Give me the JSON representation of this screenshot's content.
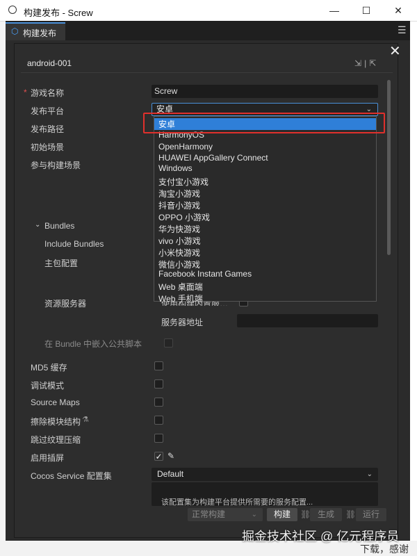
{
  "window": {
    "title": "构建发布 - Screw",
    "minimize": "—",
    "maximize": "☐",
    "close": "✕"
  },
  "tab": {
    "label": "构建发布",
    "icon": "build-icon"
  },
  "panel": {
    "config_name": "android-001",
    "close_label": "✕"
  },
  "form": {
    "game_name": {
      "label": "游戏名称",
      "value": "Screw",
      "required_mark": "*"
    },
    "platform": {
      "label": "发布平台",
      "value": "安卓"
    },
    "build_path": {
      "label": "发布路径"
    },
    "start_scene": {
      "label": "初始场景"
    },
    "build_scenes": {
      "label": "参与构建场景"
    },
    "bundles": {
      "label": "Bundles"
    },
    "include_bundles": {
      "label": "Include Bundles"
    },
    "main_bundle": {
      "label": "主包配置"
    },
    "resource_server": {
      "label": "资源服务器",
      "builtin_label": "使用构建内置服…"
    },
    "server_address": {
      "label": "服务器地址",
      "value": ""
    },
    "embed_scripts": {
      "label": "在 Bundle 中嵌入公共脚本",
      "checked": false
    },
    "md5": {
      "label": "MD5 缓存",
      "checked": false
    },
    "debug": {
      "label": "调试模式",
      "checked": false
    },
    "source_maps": {
      "label": "Source Maps",
      "checked": false
    },
    "erase_modules": {
      "label": "擦除模块结构",
      "checked": false
    },
    "skip_texture": {
      "label": "跳过纹理压缩",
      "checked": false
    },
    "splash": {
      "label": "启用插屏",
      "checked": true
    },
    "cocos_service": {
      "label": "Cocos Service 配置集",
      "value": "Default"
    },
    "service_desc": "该配置集为构建平台提供所需要的服务配置..."
  },
  "dropdown_options": [
    "安卓",
    "HarmonyOS",
    "OpenHarmony",
    "HUAWEI AppGallery Connect",
    "Windows",
    "支付宝小游戏",
    "淘宝小游戏",
    "抖音小游戏",
    "OPPO 小游戏",
    "华为快游戏",
    "vivo 小游戏",
    "小米快游戏",
    "微信小游戏",
    "Facebook Instant Games",
    "Web 桌面端",
    "Web 手机端"
  ],
  "selected_option": "安卓",
  "footer": {
    "mode": "正常构建",
    "build": "构建",
    "generate": "生成",
    "run": "运行"
  },
  "watermark": "掘金技术社区 @ 亿元程序员",
  "bottom_text": "下载，感谢"
}
